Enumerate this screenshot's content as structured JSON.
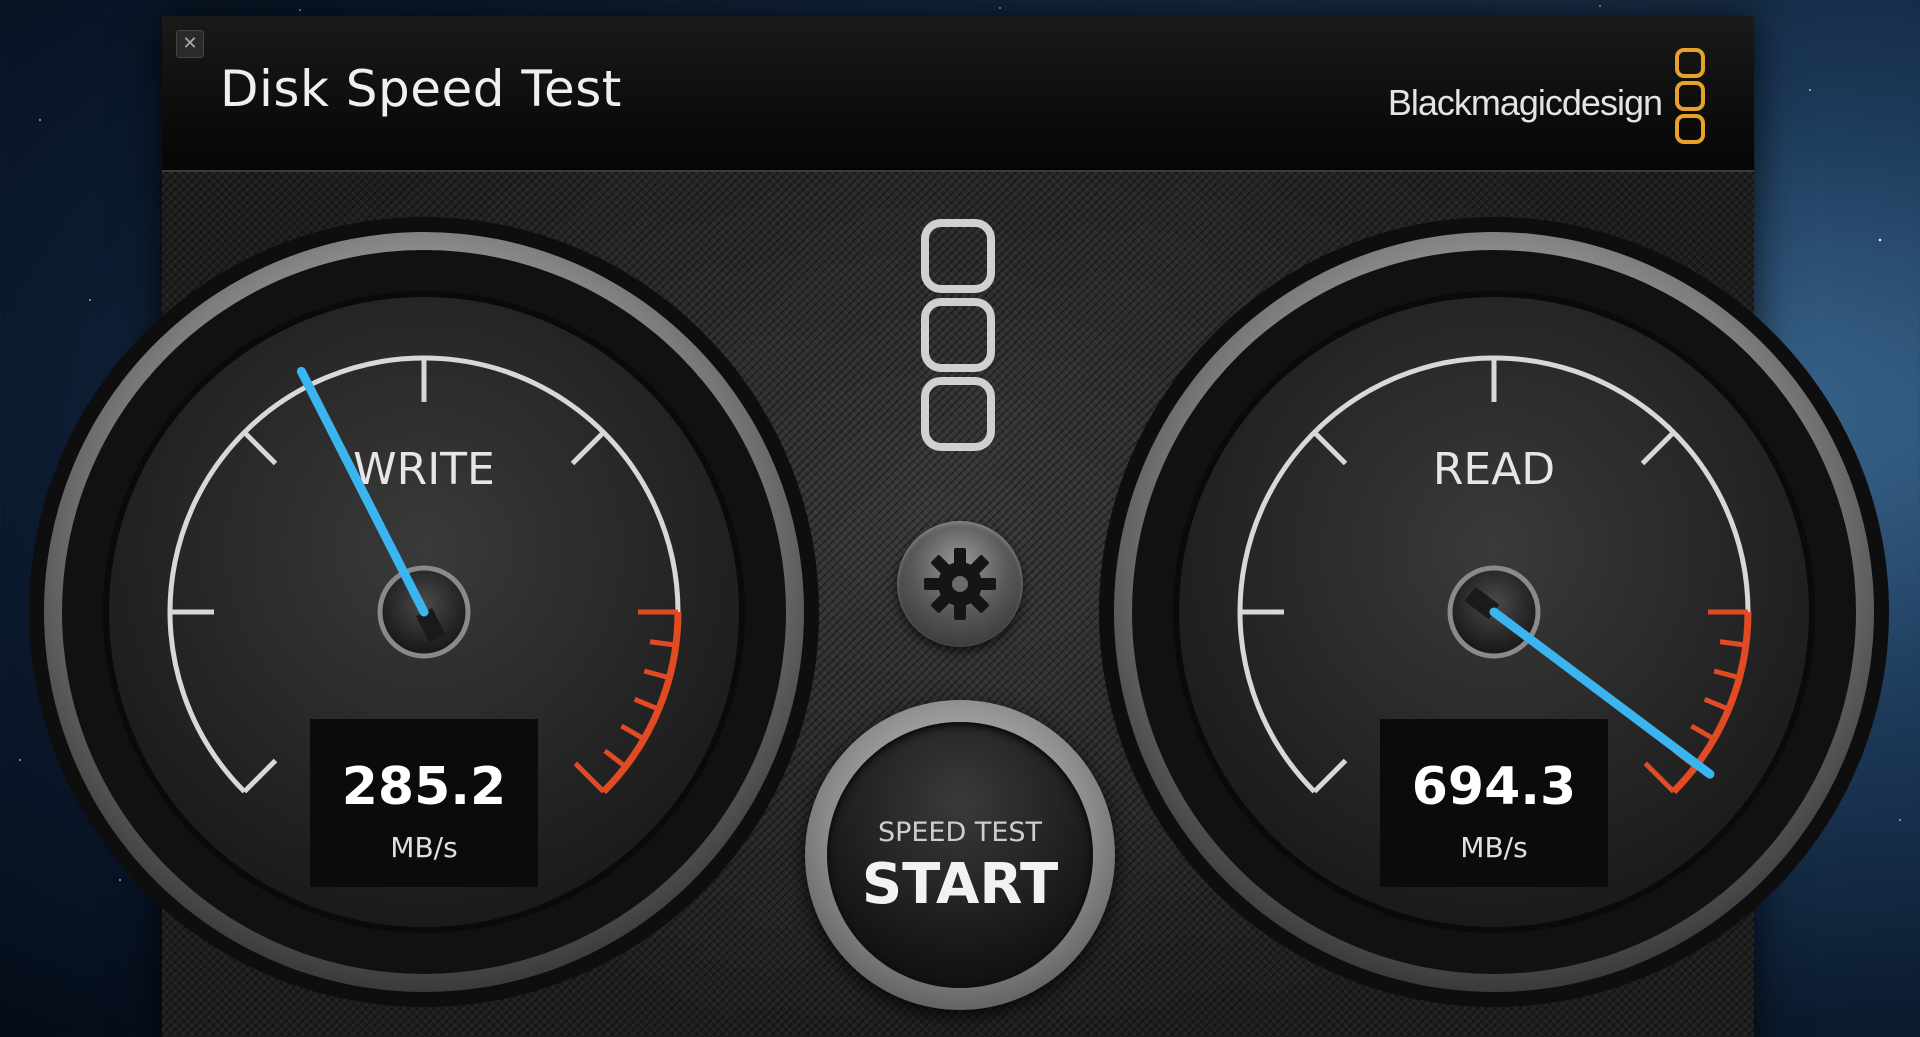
{
  "window": {
    "title": "Disk Speed Test",
    "brand": "Blackmagicdesign",
    "close_label": "✕"
  },
  "colors": {
    "needle": "#3bb5f0",
    "redline": "#e24a24",
    "brand_logo": "#e8a12a",
    "tick": "#d8d8d8"
  },
  "icons": {
    "close": "close-icon",
    "brand_logo": "blackmagic-logo-icon",
    "center_logo": "blackmagic-logo-icon",
    "settings": "gear-icon"
  },
  "gauges": {
    "write": {
      "label": "WRITE",
      "value": "285.2",
      "unit": "MB/s",
      "needle_level": 0.4
    },
    "read": {
      "label": "READ",
      "value": "694.3",
      "unit": "MB/s",
      "needle_level": 0.97
    }
  },
  "start_button": {
    "subtitle": "SPEED TEST",
    "label": "START"
  }
}
